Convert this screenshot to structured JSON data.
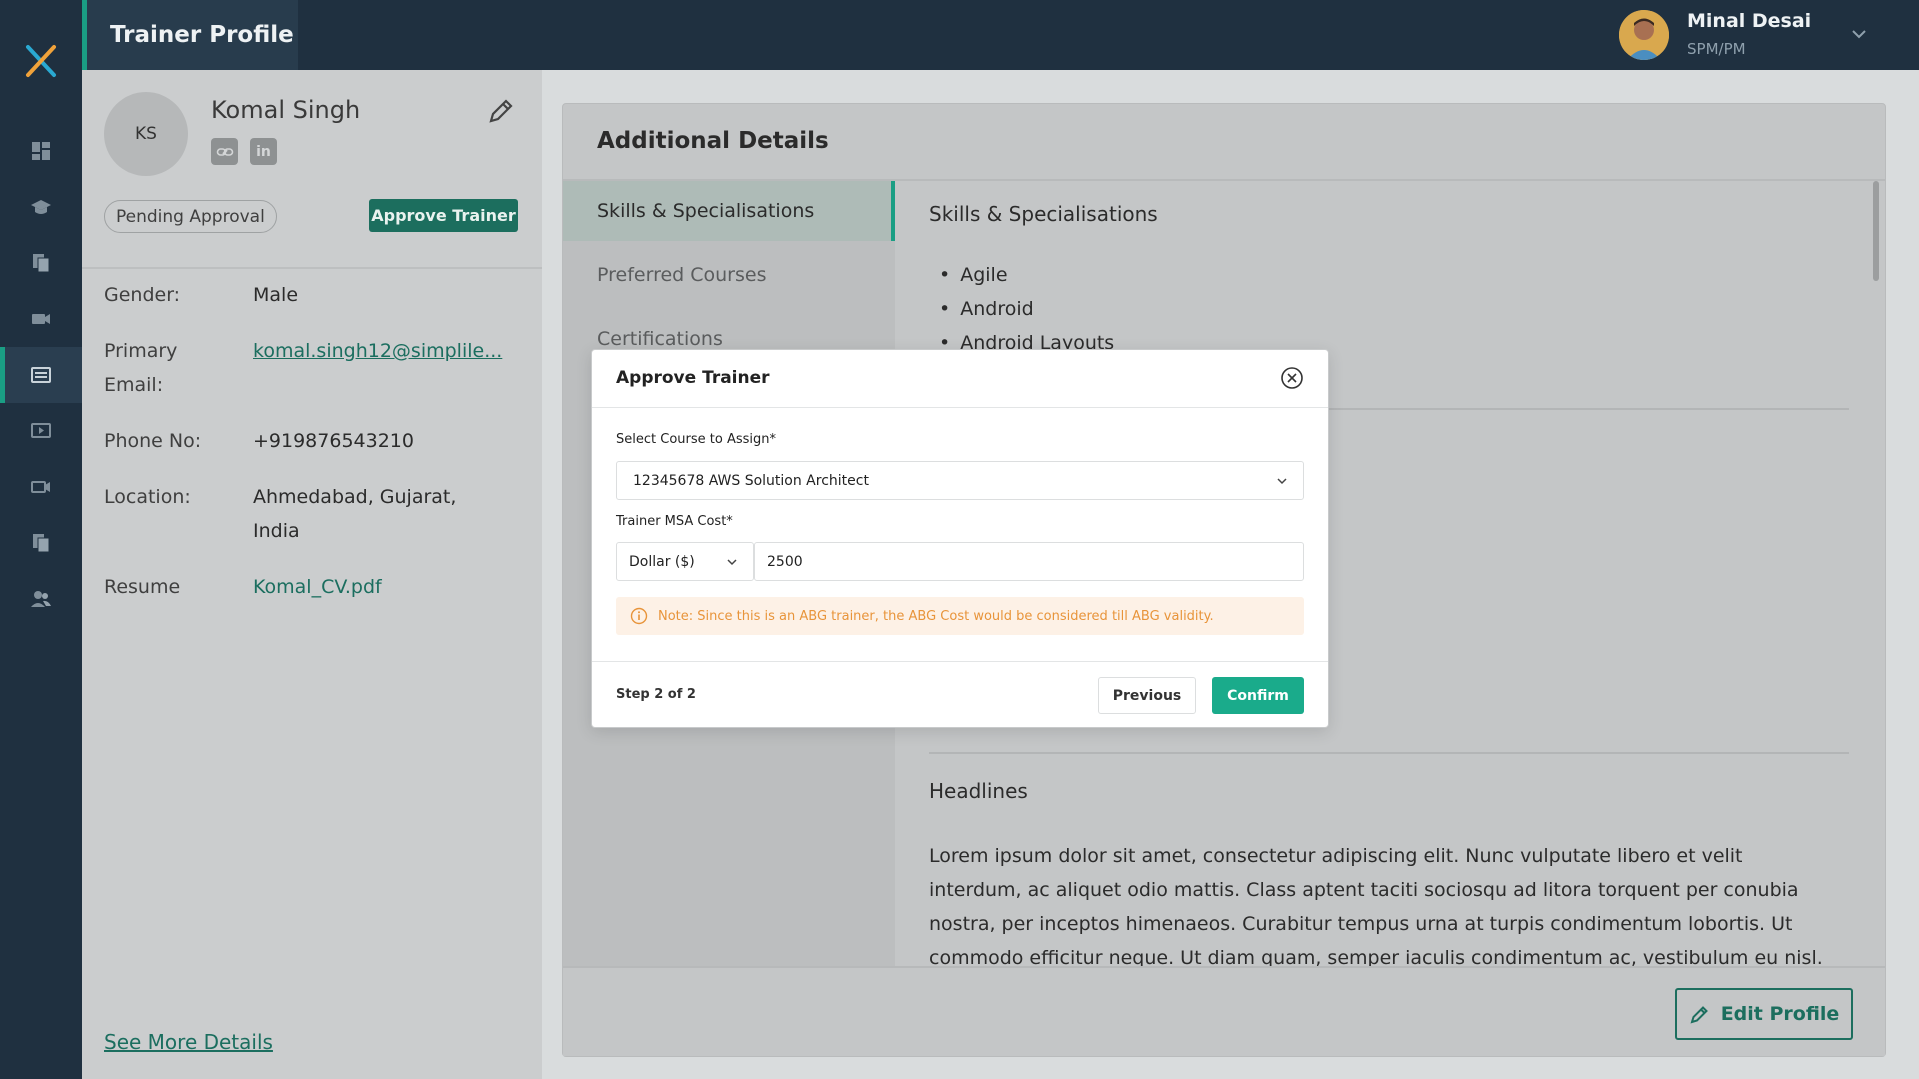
{
  "header": {
    "page_title": "Trainer Profile",
    "user": {
      "name": "Minal Desai",
      "role": "SPM/PM"
    }
  },
  "sidebar": {
    "items": [
      {
        "icon": "dashboard-icon"
      },
      {
        "icon": "graduation-cap-icon"
      },
      {
        "icon": "documents-icon"
      },
      {
        "icon": "video-camera-icon"
      },
      {
        "icon": "list-card-icon",
        "active": true
      },
      {
        "icon": "play-screen-icon"
      },
      {
        "icon": "video-record-icon"
      },
      {
        "icon": "files-icon"
      },
      {
        "icon": "users-icon"
      }
    ]
  },
  "profile": {
    "initials": "KS",
    "name": "Komal Singh",
    "status": "Pending Approval",
    "approve_label": "Approve Trainer",
    "details": {
      "gender_label": "Gender:",
      "gender_value": "Male",
      "email_label": "Primary Email:",
      "email_value": "komal.singh12@simplile...",
      "phone_label": "Phone No:",
      "phone_value": "+919876543210",
      "location_label": "Location:",
      "location_value": "Ahmedabad, Gujarat, India",
      "resume_label": "Resume",
      "resume_value": "Komal_CV.pdf"
    },
    "see_more": "See More Details"
  },
  "details_card": {
    "title": "Additional Details",
    "tabs": [
      "Skills & Specialisations",
      "Preferred Courses",
      "Certifications"
    ],
    "active_tab": 0,
    "section_title": "Skills & Specialisations",
    "skills": [
      "Agile",
      "Android",
      "Android Layouts"
    ],
    "headlines_title": "Headlines",
    "headlines_text": "Lorem ipsum dolor sit amet, consectetur adipiscing elit. Nunc vulputate libero et velit interdum, ac aliquet odio mattis. Class aptent taciti sociosqu ad litora torquent per conubia nostra, per inceptos himenaeos. Curabitur tempus urna at turpis condimentum lobortis. Ut commodo efficitur neque. Ut diam quam, semper iaculis condimentum ac, vestibulum eu nisl.",
    "edit_profile_label": "Edit Profile"
  },
  "modal": {
    "title": "Approve Trainer",
    "course_label": "Select Course to Assign*",
    "course_value": "12345678 AWS Solution Architect",
    "cost_label": "Trainer MSA Cost*",
    "currency_value": "Dollar ($)",
    "cost_value": "2500",
    "note": "Note: Since this is an ABG trainer, the ABG Cost would be considered till ABG validity.",
    "step": "Step 2 of 2",
    "previous_label": "Previous",
    "confirm_label": "Confirm"
  },
  "colors": {
    "sidebar_bg": "#1f3040",
    "accent": "#1a9e84",
    "primary_dark": "#1c6e5e",
    "confirm": "#1aab8b",
    "note_text": "#e8943a",
    "note_bg": "#fdf1e6"
  }
}
